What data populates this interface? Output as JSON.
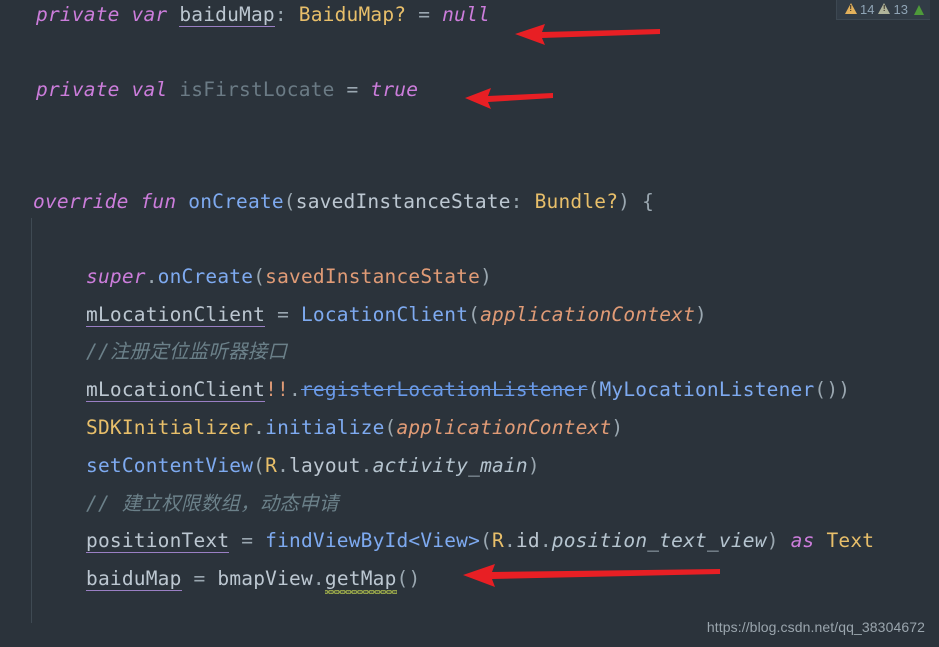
{
  "editor": {
    "theme_background": "#2b333b",
    "default_text_color": "#bcc7d1",
    "lines": {
      "l1": {
        "kw_private": "private",
        "kw_var": "var",
        "name": "baiduMap",
        "colon": ":",
        "type": "BaiduMap?",
        "eq": "=",
        "value": "null"
      },
      "l2": {
        "kw_private": "private",
        "kw_val": "val",
        "name": "isFirstLocate",
        "eq": "=",
        "value": "true"
      },
      "l3": {
        "kw_override": "override",
        "kw_fun": "fun",
        "name": "onCreate",
        "paren_open": "(",
        "param": "savedInstanceState",
        "colon": ":",
        "type": "Bundle?",
        "paren_close": ")",
        "brace": "{"
      },
      "l4": {
        "kw_super": "super",
        "dot": ".",
        "call": "onCreate",
        "paren_open": "(",
        "arg": "savedInstanceState",
        "paren_close": ")"
      },
      "l5": {
        "name": "mLocationClient",
        "eq": "=",
        "ctor": "LocationClient",
        "paren_open": "(",
        "arg": "applicationContext",
        "paren_close": ")"
      },
      "l6": {
        "comment": "//注册定位监听器接口"
      },
      "l7": {
        "name": "mLocationClient",
        "bang": "!!",
        "dot": ".",
        "deprecated_call": "registerLocationListener",
        "paren_open": "(",
        "arg_ctor": "MyLocationListener",
        "arg_parens": "()",
        "paren_close": ")"
      },
      "l8": {
        "obj": "SDKInitializer",
        "dot": ".",
        "call": "initialize",
        "paren_open": "(",
        "arg": "applicationContext",
        "paren_close": ")"
      },
      "l9": {
        "call": "setContentView",
        "paren_open": "(",
        "r": "R",
        "dot1": ".",
        "layout": "layout",
        "dot2": ".",
        "res": "activity_main",
        "paren_close": ")"
      },
      "l10": {
        "comment": "// 建立权限数组，动态申请"
      },
      "l11": {
        "name": "positionText",
        "eq": "=",
        "call": "findViewById",
        "generic": "<View>",
        "paren_open": "(",
        "r": "R",
        "dot1": ".",
        "id": "id",
        "dot2": ".",
        "res": "position_text_view",
        "paren_close": ")",
        "kw_as": "as",
        "cast_type": "Text"
      },
      "l12": {
        "name": "baiduMap",
        "eq": "=",
        "obj": "bmapView",
        "dot": ".",
        "call": "getMap",
        "parens": "()"
      }
    }
  },
  "inspection_widget": {
    "warning_icon": "warning-triangle-icon",
    "warnings_count": "14",
    "weak_warning_icon": "warning-triangle-icon",
    "weak_warnings_count": "13",
    "status_icon": "green-marker-icon",
    "colors": {
      "warning": "#e2b05b",
      "weak_warning": "#b0b49a",
      "ok": "#4e9a3a"
    }
  },
  "annotations": {
    "arrow_color": "#e81f24",
    "arrows": [
      {
        "name": "arrow-baidumap-decl",
        "points_to": "null"
      },
      {
        "name": "arrow-isfirstlocate-decl",
        "points_to": "true"
      },
      {
        "name": "arrow-getmap-call",
        "points_to": "bmapView.getMap()"
      }
    ]
  },
  "watermark": {
    "text": "https://blog.csdn.net/qq_38304672"
  }
}
